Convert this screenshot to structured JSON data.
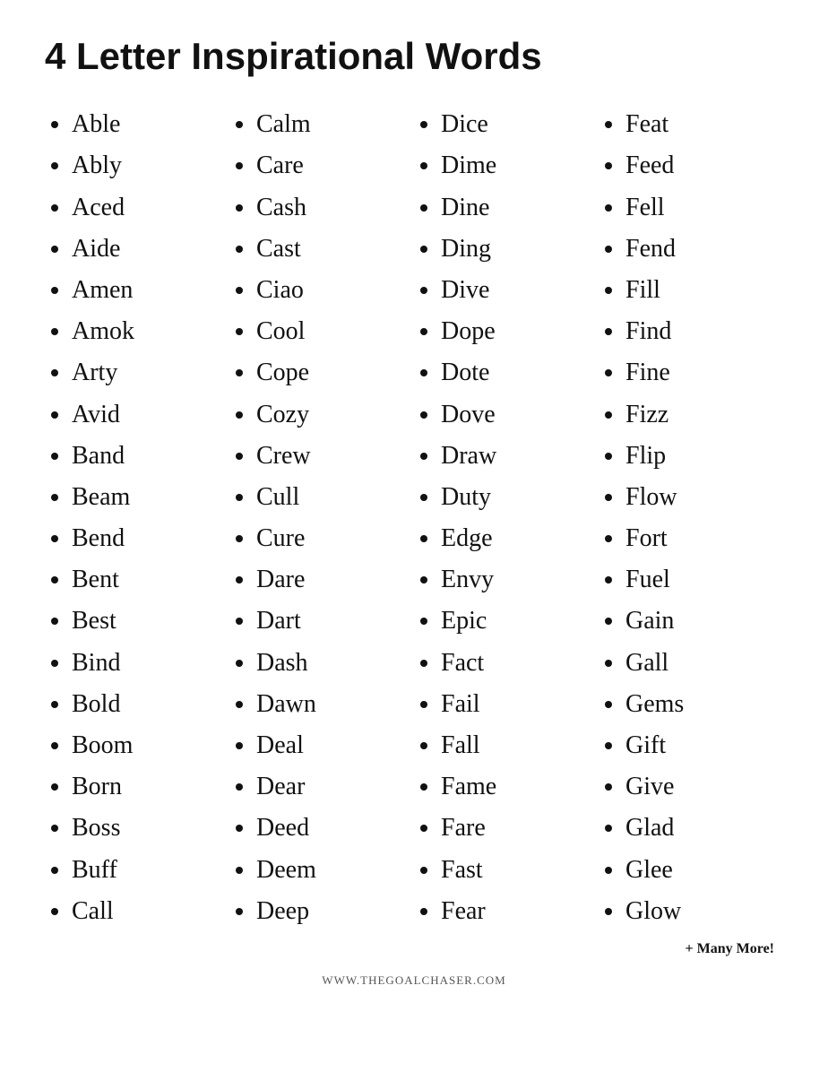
{
  "title": "4 Letter Inspirational Words",
  "columns": [
    [
      "Able",
      "Ably",
      "Aced",
      "Aide",
      "Amen",
      "Amok",
      "Arty",
      "Avid",
      "Band",
      "Beam",
      "Bend",
      "Bent",
      "Best",
      "Bind",
      "Bold",
      "Boom",
      "Born",
      "Boss",
      "Buff",
      "Call"
    ],
    [
      "Calm",
      "Care",
      "Cash",
      "Cast",
      "Ciao",
      "Cool",
      "Cope",
      "Cozy",
      "Crew",
      "Cull",
      "Cure",
      "Dare",
      "Dart",
      "Dash",
      "Dawn",
      "Deal",
      "Dear",
      "Deed",
      "Deem",
      "Deep"
    ],
    [
      "Dice",
      "Dime",
      "Dine",
      "Ding",
      "Dive",
      "Dope",
      "Dote",
      "Dove",
      "Draw",
      "Duty",
      "Edge",
      "Envy",
      "Epic",
      "Fact",
      "Fail",
      "Fall",
      "Fame",
      "Fare",
      "Fast",
      "Fear"
    ],
    [
      "Feat",
      "Feed",
      "Fell",
      "Fend",
      "Fill",
      "Find",
      "Fine",
      "Fizz",
      "Flip",
      "Flow",
      "Fort",
      "Fuel",
      "Gain",
      "Gall",
      "Gems",
      "Gift",
      "Give",
      "Glad",
      "Glee",
      "Glow"
    ]
  ],
  "more_label": "+ Many More!",
  "website": "WWW.THEGOALCHASER.COM"
}
